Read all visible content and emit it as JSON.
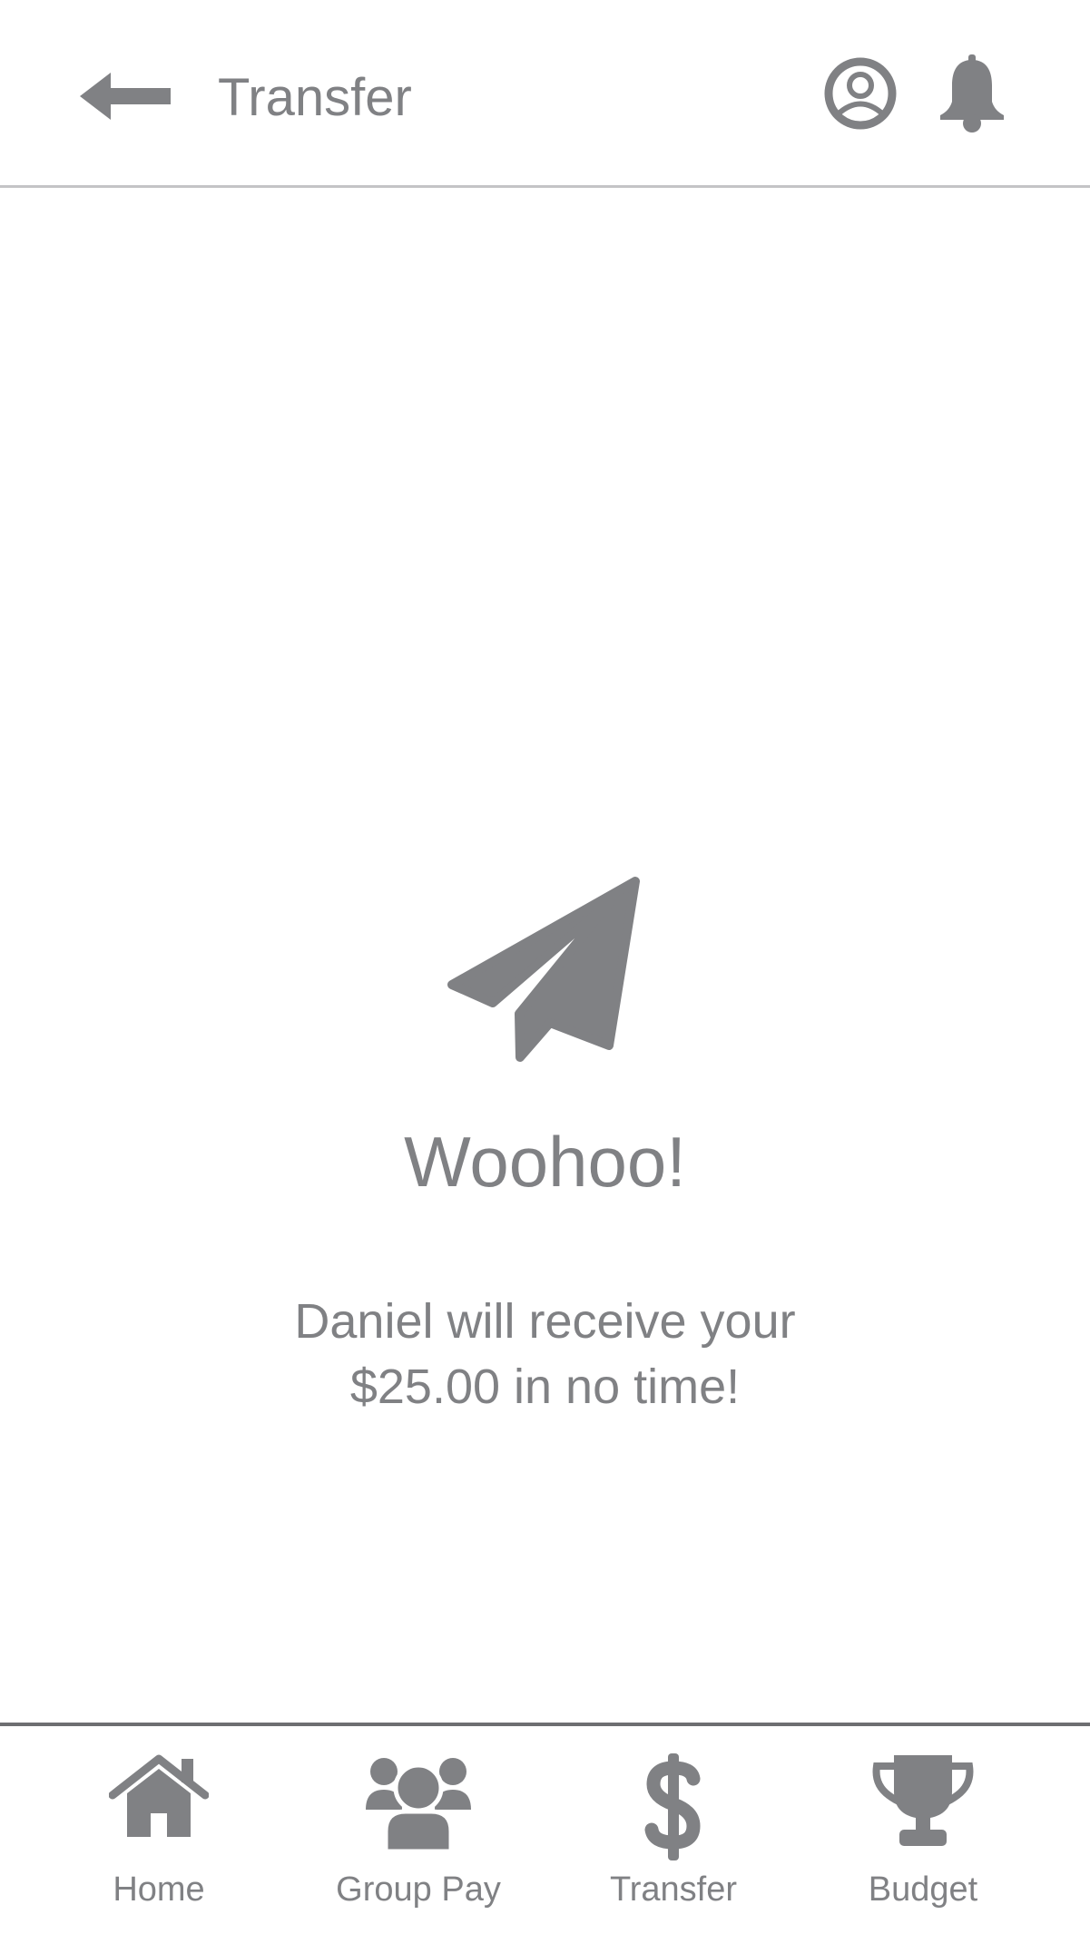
{
  "header": {
    "title": "Transfer",
    "back_icon": "arrow-left-icon",
    "profile_icon": "user-circle-icon",
    "notifications_icon": "bell-icon"
  },
  "confirmation": {
    "icon": "paper-plane-icon",
    "headline": "Woohoo!",
    "message_line1": "Daniel will receive your",
    "message_line2": "$25.00 in no time!"
  },
  "tab_bar": {
    "tabs": [
      {
        "label": "Home",
        "icon": "home-icon"
      },
      {
        "label": "Group Pay",
        "icon": "group-icon"
      },
      {
        "label": "Transfer",
        "icon": "dollar-icon"
      },
      {
        "label": "Budget",
        "icon": "trophy-icon"
      }
    ]
  },
  "colors": {
    "icon_text_gray": "#808184",
    "divider_light": "#c4c4c6",
    "divider_dark": "#6d6e71",
    "background": "#ffffff"
  }
}
